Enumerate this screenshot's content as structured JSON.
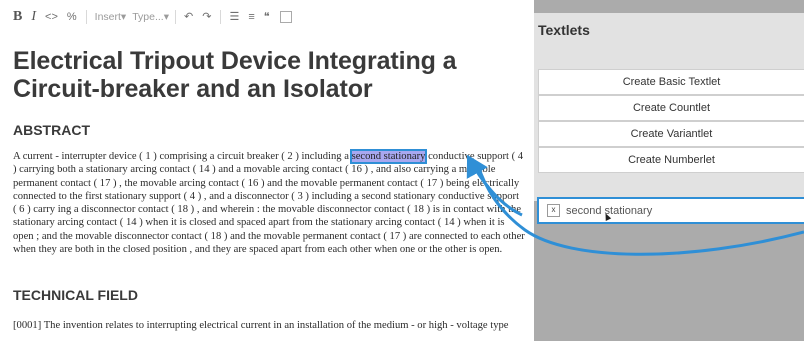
{
  "toolbar": {
    "bold": "B",
    "italic": "I",
    "code": "<>",
    "link": "%",
    "insert_label": "Insert",
    "type_label": "Type...",
    "undo": "↶",
    "redo": "↷",
    "bullet_list": "☰",
    "numbered_list": "≡",
    "quote": "❝"
  },
  "document": {
    "title": "Electrical Tripout Device Integrating a Circuit-breaker and an Isolator",
    "abstract_heading": "ABSTRACT",
    "abstract_before": "A current - interrupter device ( 1 ) comprising a circuit breaker ( 2 ) including a ",
    "abstract_highlight": "second stationary",
    "abstract_after": " conductive support ( 4 ) carrying both a stationary arcing contact ( 14 ) and a movable arcing contact ( 16 ) , and also carrying a movable permanent contact ( 17 ) , the movable arcing contact ( 16 ) and the movable permanent contact ( 17 ) being electrically connected to the first stationary support ( 4 ) , and a disconnector ( 3 ) including a second stationary conductive support ( 6 ) carry ing a disconnector contact ( 18 ) , and wherein : the movable disconnector contact ( 18 ) is in contact with the stationary arcing contact ( 14 ) when it is closed and spaced apart from the stationary arcing contact ( 14 ) when it is open ; and the movable disconnector contact ( 18 ) and the movable permanent contact ( 17 ) are connected to each other when they are both in the closed position , and they are spaced apart from each other when one or the other is open.",
    "technical_heading": "TECHNICAL FIELD",
    "technical_body": "[0001] The invention relates to interrupting electrical current in an installation of the medium - or high - voltage type"
  },
  "panel": {
    "title": "Textlets",
    "buttons": [
      "Create Basic Textlet",
      "Create Countlet",
      "Create Variantlet",
      "Create Numberlet"
    ],
    "textlet": {
      "remove": "x",
      "label": "second stationary"
    }
  },
  "colors": {
    "highlight_bg": "#a8a8f0",
    "accent_blue": "#2f8fd6",
    "panel_bg": "#ababab",
    "panel_top_bg": "#e2e2e2"
  }
}
